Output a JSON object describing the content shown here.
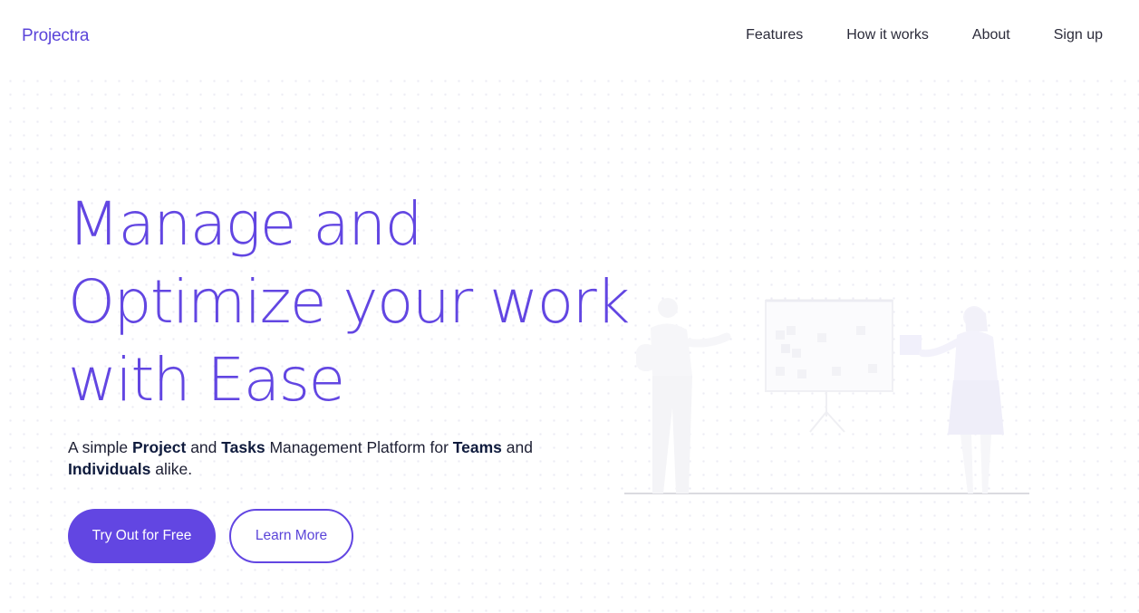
{
  "nav": {
    "logo": "Projectra",
    "links": [
      {
        "label": "Features"
      },
      {
        "label": "How it works"
      },
      {
        "label": "About"
      },
      {
        "label": "Sign up"
      }
    ]
  },
  "hero": {
    "title_lines": [
      "Manage and",
      "Optimize your work",
      "with Ease"
    ],
    "subtitle": {
      "p1": "A simple ",
      "b1": "Project",
      "p2": " and ",
      "b2": "Tasks",
      "p3": " Management Platform for ",
      "b3": "Teams",
      "p4": " and ",
      "b4": "Individuals",
      "p5": " alike."
    },
    "primary_button": "Try Out for Free",
    "secondary_button": "Learn More"
  },
  "colors": {
    "brand": "#6246e2",
    "text_dark": "#1d1f33",
    "background": "#ffffff"
  },
  "icons": {
    "illustration": "team-presentation-illustration"
  }
}
